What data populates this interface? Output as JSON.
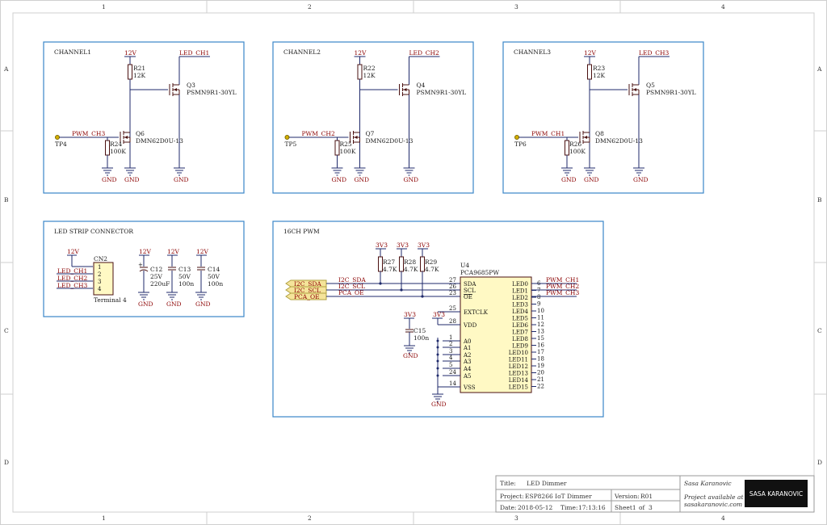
{
  "colors": {
    "block_border": "#3a86c8",
    "wire": "#1f2a6b",
    "net_label": "#8b0000",
    "port_fill": "#f5e49a",
    "ic_fill": "#fff9c4"
  },
  "frame": {
    "col_labels": [
      "1",
      "2",
      "3",
      "4"
    ],
    "row_labels": [
      "A",
      "B",
      "C",
      "D"
    ]
  },
  "blocks": {
    "ch1": "CHANNEL1",
    "ch2": "CHANNEL2",
    "ch3": "CHANNEL3",
    "conn": "LED STRIP CONNECTOR",
    "pwm": "16CH PWM"
  },
  "channels": [
    {
      "vcc": "12V",
      "out": "LED_CH1",
      "pullup_ref": "R21",
      "pullup_val": "12K",
      "fet_hi_ref": "Q3",
      "fet_hi_part": "PSMN9R1-30YL",
      "pwm_net": "PWM_CH3",
      "tp": "TP4",
      "fet_lo_ref": "Q6",
      "fet_lo_part": "DMN62D0U-13",
      "pd_ref": "R24",
      "pd_val": "100K",
      "gnd": "GND"
    },
    {
      "vcc": "12V",
      "out": "LED_CH2",
      "pullup_ref": "R22",
      "pullup_val": "12K",
      "fet_hi_ref": "Q4",
      "fet_hi_part": "PSMN9R1-30YL",
      "pwm_net": "PWM_CH2",
      "tp": "TP5",
      "fet_lo_ref": "Q7",
      "fet_lo_part": "DMN62D0U-13",
      "pd_ref": "R25",
      "pd_val": "100K",
      "gnd": "GND"
    },
    {
      "vcc": "12V",
      "out": "LED_CH3",
      "pullup_ref": "R23",
      "pullup_val": "12K",
      "fet_hi_ref": "Q5",
      "fet_hi_part": "PSMN9R1-30YL",
      "pwm_net": "PWM_CH1",
      "tp": "TP6",
      "fet_lo_ref": "Q8",
      "fet_lo_part": "DMN62D0U-13",
      "pd_ref": "R26",
      "pd_val": "100K",
      "gnd": "GND"
    }
  ],
  "connector": {
    "ref": "CN2",
    "name": "Terminal 4",
    "vcc": "12V",
    "pins": [
      "1",
      "2",
      "3",
      "4"
    ],
    "nets": [
      "LED_CH1",
      "LED_CH2",
      "LED_CH3"
    ],
    "caps": [
      {
        "ref": "C12",
        "v": "25V",
        "val": "220uF",
        "vcc": "12V",
        "gnd": "GND"
      },
      {
        "ref": "C13",
        "v": "50V",
        "val": "100n",
        "vcc": "12V",
        "gnd": "GND"
      },
      {
        "ref": "C14",
        "v": "50V",
        "val": "100n",
        "vcc": "12V",
        "gnd": "GND"
      }
    ]
  },
  "pwm": {
    "ref": "U4",
    "part": "PCA9685PW",
    "v3": "3V3",
    "pullups": [
      {
        "ref": "R27",
        "val": "4.7K"
      },
      {
        "ref": "R28",
        "val": "4.7K"
      },
      {
        "ref": "R29",
        "val": "4.7K"
      }
    ],
    "ports": [
      "I2C_SDA",
      "I2C_SCL",
      "PCA_OE"
    ],
    "left_pins": [
      {
        "num": "27",
        "name": "SDA"
      },
      {
        "num": "26",
        "name": "SCL"
      },
      {
        "num": "23",
        "name": "OE"
      },
      {
        "num": "25",
        "name": "EXTCLK"
      },
      {
        "num": "28",
        "name": "VDD"
      },
      {
        "num": "1",
        "name": "A0"
      },
      {
        "num": "2",
        "name": "A1"
      },
      {
        "num": "3",
        "name": "A2"
      },
      {
        "num": "4",
        "name": "A3"
      },
      {
        "num": "5",
        "name": "A4"
      },
      {
        "num": "24",
        "name": "A5"
      },
      {
        "num": "14",
        "name": "VSS"
      }
    ],
    "right_pins": [
      {
        "num": "6",
        "name": "LED0"
      },
      {
        "num": "7",
        "name": "LED1"
      },
      {
        "num": "8",
        "name": "LED2"
      },
      {
        "num": "9",
        "name": "LED3"
      },
      {
        "num": "10",
        "name": "LED4"
      },
      {
        "num": "11",
        "name": "LED5"
      },
      {
        "num": "12",
        "name": "LED6"
      },
      {
        "num": "13",
        "name": "LED7"
      },
      {
        "num": "15",
        "name": "LED8"
      },
      {
        "num": "16",
        "name": "LED9"
      },
      {
        "num": "17",
        "name": "LED10"
      },
      {
        "num": "18",
        "name": "LED11"
      },
      {
        "num": "19",
        "name": "LED12"
      },
      {
        "num": "20",
        "name": "LED13"
      },
      {
        "num": "21",
        "name": "LED14"
      },
      {
        "num": "22",
        "name": "LED15"
      }
    ],
    "out_nets": [
      "PWM_CH1",
      "PWM_CH2",
      "PWM_CH3"
    ],
    "cap": {
      "ref": "C15",
      "val": "100n"
    },
    "gnd": "GND"
  },
  "titleblock": {
    "title_label": "Title:",
    "title": "LED Dimmer",
    "project_label": "Project:",
    "project": "ESP8266 IoT Dimmer",
    "version_label": "Version:",
    "version": "R01",
    "date_label": "Date:",
    "date": "2018-05-12",
    "time_label": "Time:",
    "time": "17:13:16",
    "sheet": "Sheet1",
    "of": "of",
    "total": "3",
    "author": "Sasa Karanovic",
    "avail1": "Project available at",
    "avail2": "sasakaranovic.com",
    "logo": "SASA KARANOVIC"
  }
}
